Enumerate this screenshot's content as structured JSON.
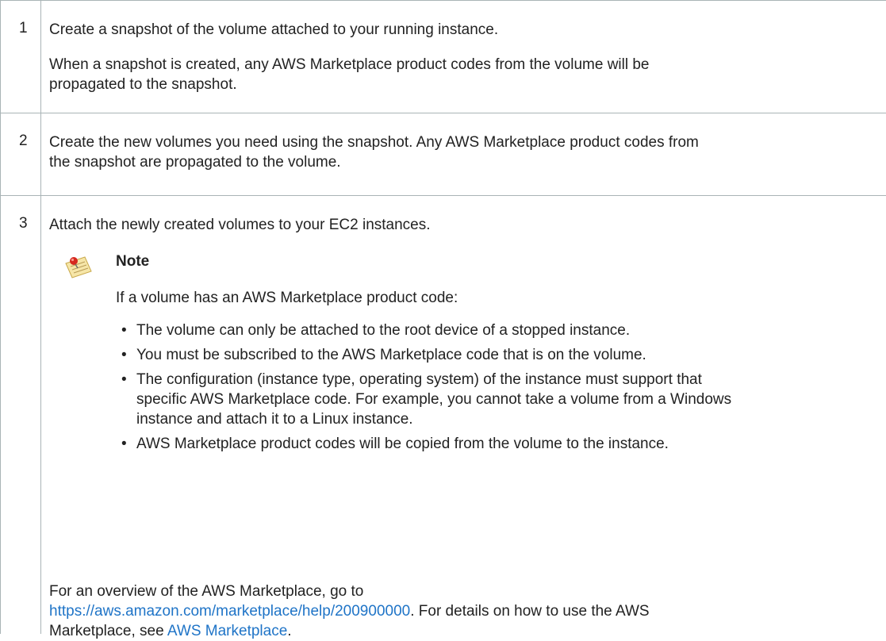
{
  "steps": [
    {
      "number": "1",
      "lines": [
        "Create a snapshot of the volume attached to your running instance."
      ],
      "detail_lines": [
        "When a snapshot is created, any AWS Marketplace product codes from the volume will be",
        "propagated to the snapshot."
      ]
    },
    {
      "number": "2",
      "lines": [
        "Create the new volumes you need using the snapshot. Any AWS Marketplace product codes from",
        "the snapshot are propagated to the volume."
      ]
    },
    {
      "number": "3",
      "lines": [
        "Attach the newly created volumes to your EC2 instances."
      ],
      "note": {
        "icon": "note-pushpin-icon",
        "title": "Note",
        "intro": "If a volume has an AWS Marketplace product code:",
        "bullets": [
          [
            "The volume can only be attached to the root device of a stopped instance."
          ],
          [
            "You must be subscribed to the AWS Marketplace code that is on the volume."
          ],
          [
            "The configuration (instance type, operating system) of the instance must support that",
            "specific AWS Marketplace code. For example, you cannot take a volume from a Windows",
            "instance and attach it to a Linux instance."
          ],
          [
            "AWS Marketplace product codes will be copied from the volume to the instance."
          ]
        ]
      },
      "overview": {
        "line1": "For an overview of the AWS Marketplace, go to",
        "link1": "https://aws.amazon.com/marketplace/help/200900000",
        "after_link1": ". For details on how to use the AWS",
        "line3_prefix": "Marketplace, see ",
        "link2": "AWS Marketplace",
        "line3_suffix": "."
      }
    }
  ],
  "colors": {
    "border": "#a9b4b6",
    "text": "#222222",
    "link": "#1f74c7"
  }
}
